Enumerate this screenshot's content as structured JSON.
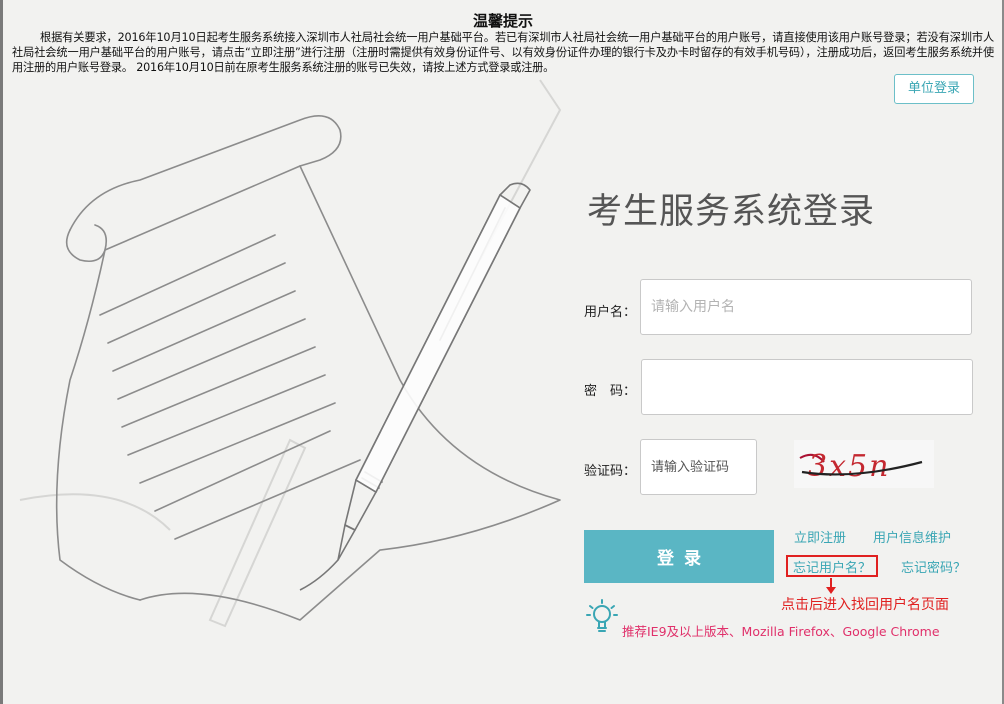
{
  "notice": {
    "title": "温馨提示",
    "body": "根据有关要求，2016年10月10日起考生服务系统接入深圳市人社局社会统一用户基础平台。若已有深圳市人社局社会统一用户基础平台的用户账号，请直接使用该用户账号登录；若没有深圳市人社局社会统一用户基础平台的用户账号，请点击“立即注册”进行注册（注册时需提供有效身份证件号、以有效身份证件办理的银行卡及办卡时留存的有效手机号码），注册成功后，返回考生服务系统并使用注册的用户账号登录。 2016年10月10日前在原考生服务系统注册的账号已失效，请按上述方式登录或注册。"
  },
  "header": {
    "org_login_label": "单位登录"
  },
  "login": {
    "title": "考生服务系统登录",
    "username_label": "用户名：",
    "username_placeholder": "请输入用户名",
    "password_label": "密　码：",
    "captcha_label": "验证码：",
    "captcha_placeholder": "请输入验证码",
    "captcha_text": "3x5n",
    "submit_label": "登录"
  },
  "links": {
    "register": "立即注册",
    "user_info": "用户信息维护",
    "forgot_username": "忘记用户名？",
    "forgot_password": "忘记密码？"
  },
  "annotation": {
    "text": "点击后进入找回用户名页面"
  },
  "tips": {
    "browser": "推荐IE9及以上版本、Mozilla Firefox、Google Chrome"
  },
  "colors": {
    "accent": "#5ab6c4",
    "link": "#3aa6b4",
    "annotation": "#e02020",
    "tip": "#e0306a"
  },
  "icons": {
    "tip": "lightbulb-icon",
    "annotation": "arrow-down-icon"
  }
}
